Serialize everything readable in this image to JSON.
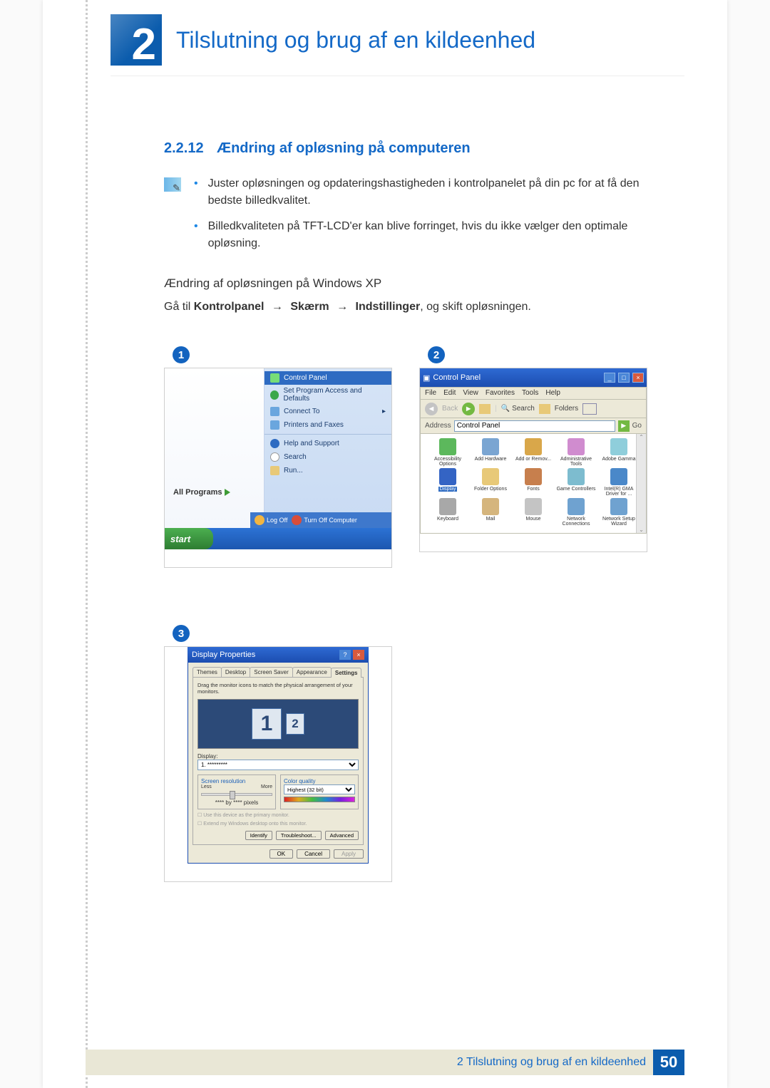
{
  "chapter": {
    "num": "2",
    "title": "Tilslutning og brug af en kildeenhed"
  },
  "section": {
    "num": "2.2.12",
    "title": "Ændring af opløsning på computeren"
  },
  "notes": [
    "Juster opløsningen og opdateringshastigheden i kontrolpanelet på din pc for at få den bedste billedkvalitet.",
    "Billedkvaliteten på TFT-LCD'er kan blive forringet, hvis du ikke vælger den optimale opløsning."
  ],
  "subhead": "Ændring af opløsningen på Windows XP",
  "path": {
    "pre": "Gå til ",
    "a": "Kontrolpanel",
    "b": "Skærm",
    "c": "Indstillinger",
    "post": ", og skift opløsningen."
  },
  "badge1": "1",
  "badge2": "2",
  "badge3": "3",
  "startmenu": {
    "all_programs": "All Programs",
    "items": [
      "Control Panel",
      "Set Program Access and Defaults",
      "Connect To",
      "Printers and Faxes",
      "Help and Support",
      "Search",
      "Run..."
    ],
    "logoff": "Log Off",
    "turnoff": "Turn Off Computer",
    "start": "start"
  },
  "cp": {
    "title": "Control Panel",
    "address_label": "Address",
    "address_value": "Control Panel",
    "go": "Go",
    "menu": [
      "File",
      "Edit",
      "View",
      "Favorites",
      "Tools",
      "Help"
    ],
    "toolbar": {
      "back": "Back",
      "search": "Search",
      "folders": "Folders"
    },
    "icons": [
      "Accessibility Options",
      "Add Hardware",
      "Add or Remov...",
      "Administrative Tools",
      "Adobe Gamma",
      "Display",
      "Folder Options",
      "Fonts",
      "Game Controllers",
      "Intel(R) GMA Driver for ...",
      "Keyboard",
      "Mail",
      "Mouse",
      "Network Connections",
      "Network Setup Wizard"
    ],
    "selected_index": 5
  },
  "dp": {
    "title": "Display Properties",
    "tabs": [
      "Themes",
      "Desktop",
      "Screen Saver",
      "Appearance",
      "Settings"
    ],
    "active_tab": 4,
    "hint": "Drag the monitor icons to match the physical arrangement of your monitors.",
    "mon1": "1",
    "mon2": "2",
    "display_label": "Display:",
    "display_value": "1. *********",
    "res_group": "Screen resolution",
    "less": "Less",
    "more": "More",
    "res_value": "**** by **** pixels",
    "quality_group": "Color quality",
    "quality_value": "Highest (32 bit)",
    "chk1": "Use this device as the primary monitor.",
    "chk2": "Extend my Windows desktop onto this monitor.",
    "identify": "Identify",
    "troubleshoot": "Troubleshoot...",
    "advanced": "Advanced",
    "ok": "OK",
    "cancel": "Cancel",
    "apply": "Apply"
  },
  "footer": {
    "text": "2 Tilslutning og brug af en kildeenhed",
    "page": "50"
  }
}
